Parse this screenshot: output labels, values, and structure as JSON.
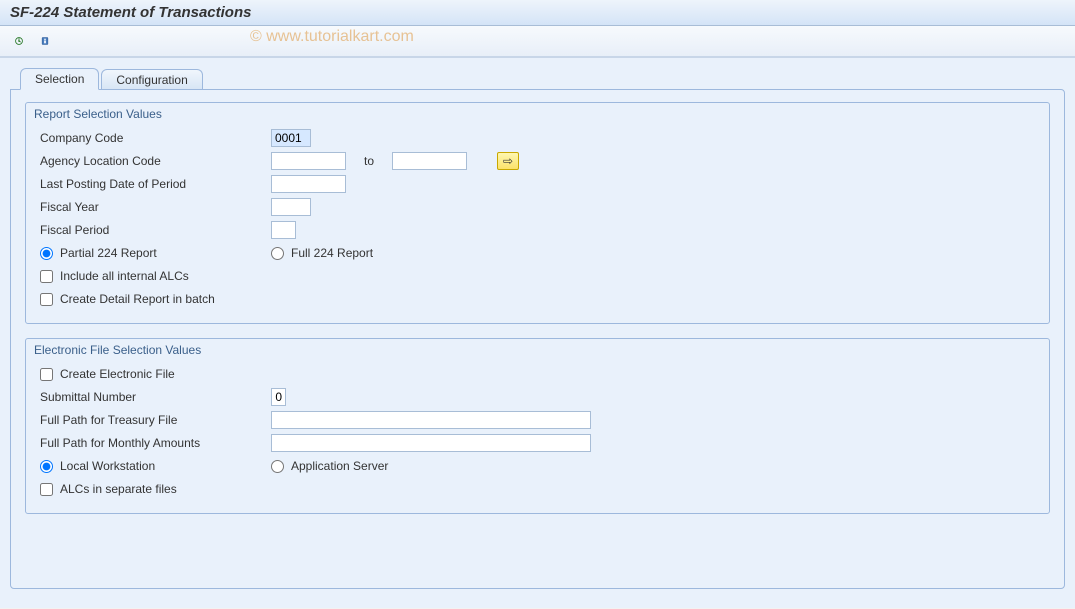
{
  "title": "SF-224 Statement of Transactions",
  "watermark": "© www.tutorialkart.com",
  "tabs": {
    "selection": "Selection",
    "configuration": "Configuration"
  },
  "group1": {
    "title": "Report Selection Values",
    "company_code_label": "Company Code",
    "company_code_value": "0001",
    "agency_loc_label": "Agency Location Code",
    "agency_loc_from": "",
    "to_label": "to",
    "agency_loc_to": "",
    "last_posting_label": "Last Posting Date of Period",
    "last_posting_value": "",
    "fiscal_year_label": "Fiscal Year",
    "fiscal_year_value": "",
    "fiscal_period_label": "Fiscal Period",
    "fiscal_period_value": "",
    "partial_label": "Partial 224 Report",
    "full_label": "Full 224 Report",
    "include_alcs_label": "Include all internal ALCs",
    "create_detail_label": "Create Detail Report in batch"
  },
  "group2": {
    "title": "Electronic File Selection Values",
    "create_file_label": "Create Electronic File",
    "submittal_label": "Submittal Number",
    "submittal_value": "0",
    "treasury_path_label": "Full Path for Treasury File",
    "treasury_path_value": "",
    "monthly_path_label": "Full Path for Monthly Amounts",
    "monthly_path_value": "",
    "local_ws_label": "Local Workstation",
    "app_server_label": "Application Server",
    "alcs_sep_label": "ALCs in separate files"
  }
}
